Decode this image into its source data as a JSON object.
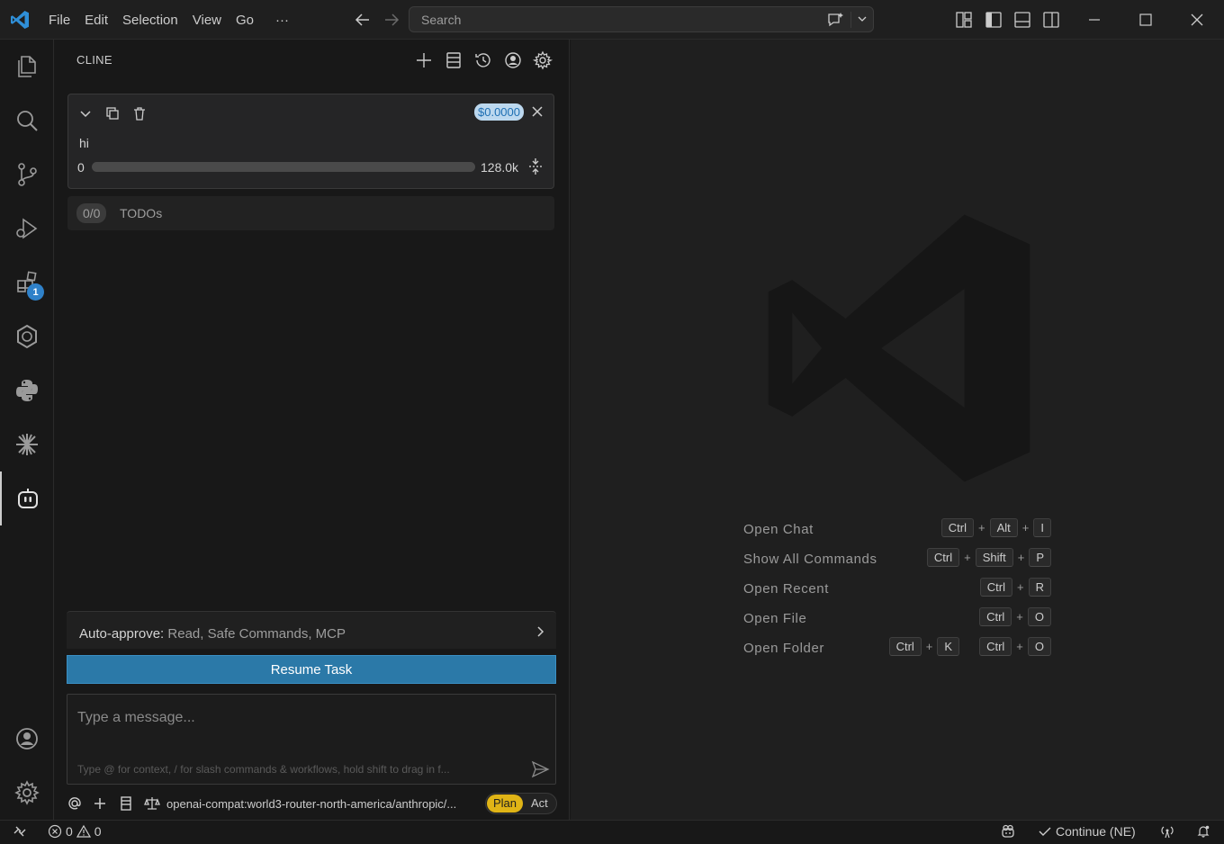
{
  "menu": {
    "items": [
      "File",
      "Edit",
      "Selection",
      "View",
      "Go",
      "···"
    ]
  },
  "search": {
    "placeholder": "Search"
  },
  "sidebar": {
    "title": "CLINE"
  },
  "task": {
    "cost": "$0.0000",
    "text": "hi",
    "tokens_used": "0",
    "context_window": "128.0k",
    "context_used_fraction": 0
  },
  "todos": {
    "count": "0/0",
    "label": "TODOs"
  },
  "auto_approve": {
    "label": "Auto-approve:",
    "values": "Read, Safe Commands, MCP"
  },
  "resume_button": "Resume Task",
  "chat": {
    "placeholder": "Type a message...",
    "hint": "Type @ for context, / for slash commands & workflows, hold shift to drag in f..."
  },
  "toolbar": {
    "model": "openai-compat:world3-router-north-america/anthropic/...",
    "mode_plan": "Plan",
    "mode_act": "Act",
    "active_mode": "Plan"
  },
  "activity_badge": "1",
  "welcome": {
    "shortcuts": [
      {
        "label": "Open Chat",
        "keys": [
          "Ctrl",
          "Alt",
          "I"
        ]
      },
      {
        "label": "Show All Commands",
        "keys": [
          "Ctrl",
          "Shift",
          "P"
        ]
      },
      {
        "label": "Open Recent",
        "keys": [
          "Ctrl",
          "R"
        ]
      },
      {
        "label": "Open File",
        "keys": [
          "Ctrl",
          "O"
        ]
      },
      {
        "label": "Open Folder",
        "keys": [
          "Ctrl",
          "K",
          "Ctrl",
          "O"
        ]
      }
    ]
  },
  "status": {
    "errors": "0",
    "warnings": "0",
    "continue": "Continue (NE)"
  },
  "colors": {
    "accent": "#2b79a8",
    "plan": "#e0b416",
    "badge": "#2f81c9"
  }
}
